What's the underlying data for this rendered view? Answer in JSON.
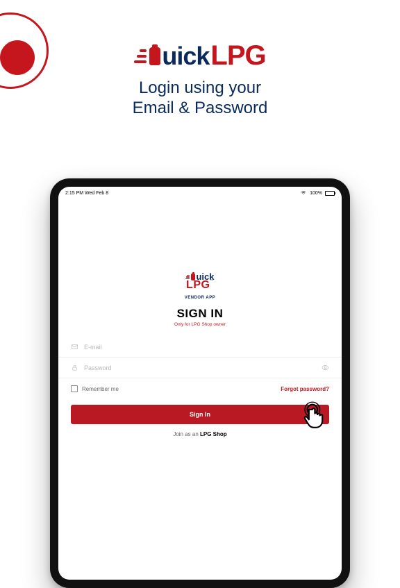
{
  "logo": {
    "brand_left": "uick",
    "brand_right": "LPG"
  },
  "tagline_l1": "Login using your",
  "tagline_l2": "Email & Password",
  "statusbar": {
    "time_date": "2:15 PM   Wed Feb 8",
    "battery": "100%"
  },
  "mini_logo": {
    "quick": "uick",
    "lpg": "LPG",
    "tm": "™"
  },
  "vendor_app": "VENDOR APP",
  "signin": {
    "title": "SIGN IN",
    "subtitle": "Only for LPG Shop owner",
    "email_placeholder": "E-mail",
    "password_placeholder": "Password",
    "remember": "Remember me",
    "forgot": "Forgot password?",
    "button": "Sign In",
    "join_prefix": "Join as an ",
    "join_bold": "LPG Shop"
  }
}
